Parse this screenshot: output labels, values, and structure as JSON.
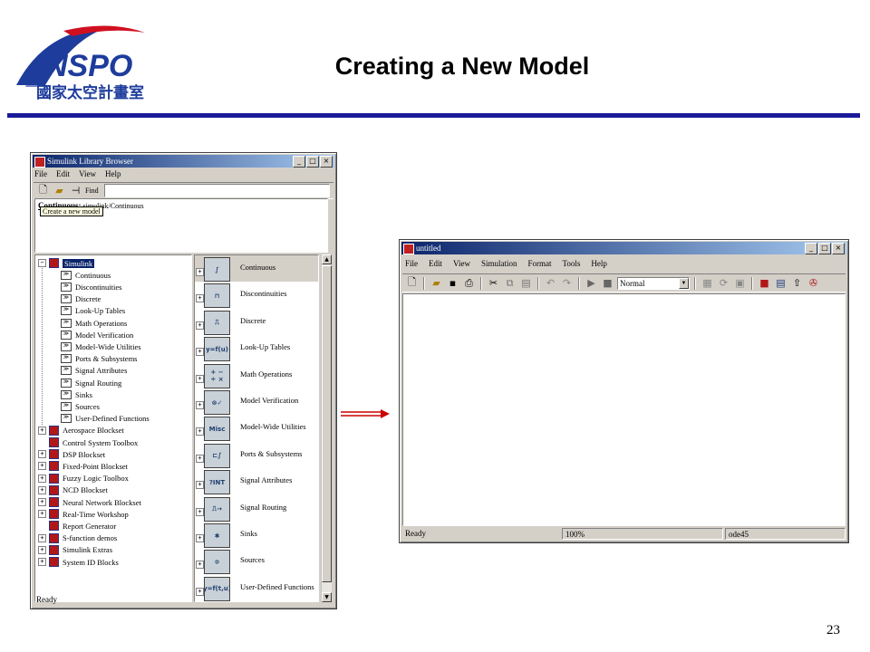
{
  "slide": {
    "title": "Creating a New Model",
    "page_number": "23",
    "logo_text": "NSPO",
    "logo_subtitle": "國家太空計畫室"
  },
  "library_browser": {
    "title": "Simulink Library Browser",
    "menu": [
      "File",
      "Edit",
      "View",
      "Help"
    ],
    "find_label": "Find",
    "description_title": "Continuous:",
    "description_path": "simulink/Continuous",
    "tooltip": "Create a new model",
    "status": "Ready",
    "tree": [
      {
        "label": "Simulink",
        "level": 0,
        "expander": "−",
        "icon": "library",
        "selected": true
      },
      {
        "label": "Continuous",
        "level": 1,
        "icon": "block"
      },
      {
        "label": "Discontinuities",
        "level": 1,
        "icon": "block"
      },
      {
        "label": "Discrete",
        "level": 1,
        "icon": "block"
      },
      {
        "label": "Look-Up Tables",
        "level": 1,
        "icon": "block"
      },
      {
        "label": "Math Operations",
        "level": 1,
        "icon": "block"
      },
      {
        "label": "Model Verification",
        "level": 1,
        "icon": "block"
      },
      {
        "label": "Model-Wide Utilities",
        "level": 1,
        "icon": "block"
      },
      {
        "label": "Ports & Subsystems",
        "level": 1,
        "icon": "block"
      },
      {
        "label": "Signal Attributes",
        "level": 1,
        "icon": "block"
      },
      {
        "label": "Signal Routing",
        "level": 1,
        "icon": "block"
      },
      {
        "label": "Sinks",
        "level": 1,
        "icon": "block"
      },
      {
        "label": "Sources",
        "level": 1,
        "icon": "block"
      },
      {
        "label": "User-Defined Functions",
        "level": 1,
        "icon": "block"
      },
      {
        "label": "Aerospace Blockset",
        "level": 0,
        "expander": "+",
        "icon": "library"
      },
      {
        "label": "Control System Toolbox",
        "level": 0,
        "expander": "",
        "icon": "library"
      },
      {
        "label": "DSP Blockset",
        "level": 0,
        "expander": "+",
        "icon": "library"
      },
      {
        "label": "Fixed-Point Blockset",
        "level": 0,
        "expander": "+",
        "icon": "library"
      },
      {
        "label": "Fuzzy Logic Toolbox",
        "level": 0,
        "expander": "+",
        "icon": "library"
      },
      {
        "label": "NCD Blockset",
        "level": 0,
        "expander": "+",
        "icon": "library"
      },
      {
        "label": "Neural Network Blockset",
        "level": 0,
        "expander": "+",
        "icon": "library"
      },
      {
        "label": "Real-Time Workshop",
        "level": 0,
        "expander": "+",
        "icon": "library"
      },
      {
        "label": "Report Generator",
        "level": 0,
        "expander": "",
        "icon": "library"
      },
      {
        "label": "S-function demos",
        "level": 0,
        "expander": "+",
        "icon": "library"
      },
      {
        "label": "Simulink Extras",
        "level": 0,
        "expander": "+",
        "icon": "library"
      },
      {
        "label": "System ID Blocks",
        "level": 0,
        "expander": "+",
        "icon": "library"
      }
    ],
    "blocks": [
      {
        "label": "Continuous",
        "glyph": "∫",
        "active": true
      },
      {
        "label": "Discontinuities",
        "glyph": "⊓"
      },
      {
        "label": "Discrete",
        "glyph": "⎍"
      },
      {
        "label": "Look-Up Tables",
        "glyph": "y=f(u)"
      },
      {
        "label": "Math Operations",
        "glyph": "+ −\n÷ ×"
      },
      {
        "label": "Model Verification",
        "glyph": "⊗✓"
      },
      {
        "label": "Model-Wide Utilities",
        "glyph": "Misc"
      },
      {
        "label": "Ports & Subsystems",
        "glyph": "⊏∫"
      },
      {
        "label": "Signal Attributes",
        "glyph": "?INT"
      },
      {
        "label": "Signal Routing",
        "glyph": "⎍→"
      },
      {
        "label": "Sinks",
        "glyph": "✱"
      },
      {
        "label": "Sources",
        "glyph": "✲"
      },
      {
        "label": "User-Defined Functions",
        "glyph": "y=f(t,u)"
      }
    ]
  },
  "model_window": {
    "title": "untitled",
    "menu": [
      "File",
      "Edit",
      "View",
      "Simulation",
      "Format",
      "Tools",
      "Help"
    ],
    "sim_mode": "Normal",
    "status": {
      "left": "Ready",
      "zoom": "100%",
      "solver": "ode45"
    }
  },
  "colors": {
    "title_bar": "#0a246a",
    "rule": "#1a1a9a",
    "arrow": "#cc0000",
    "logo_blue": "#1e3c9c",
    "logo_red": "#d01020"
  }
}
